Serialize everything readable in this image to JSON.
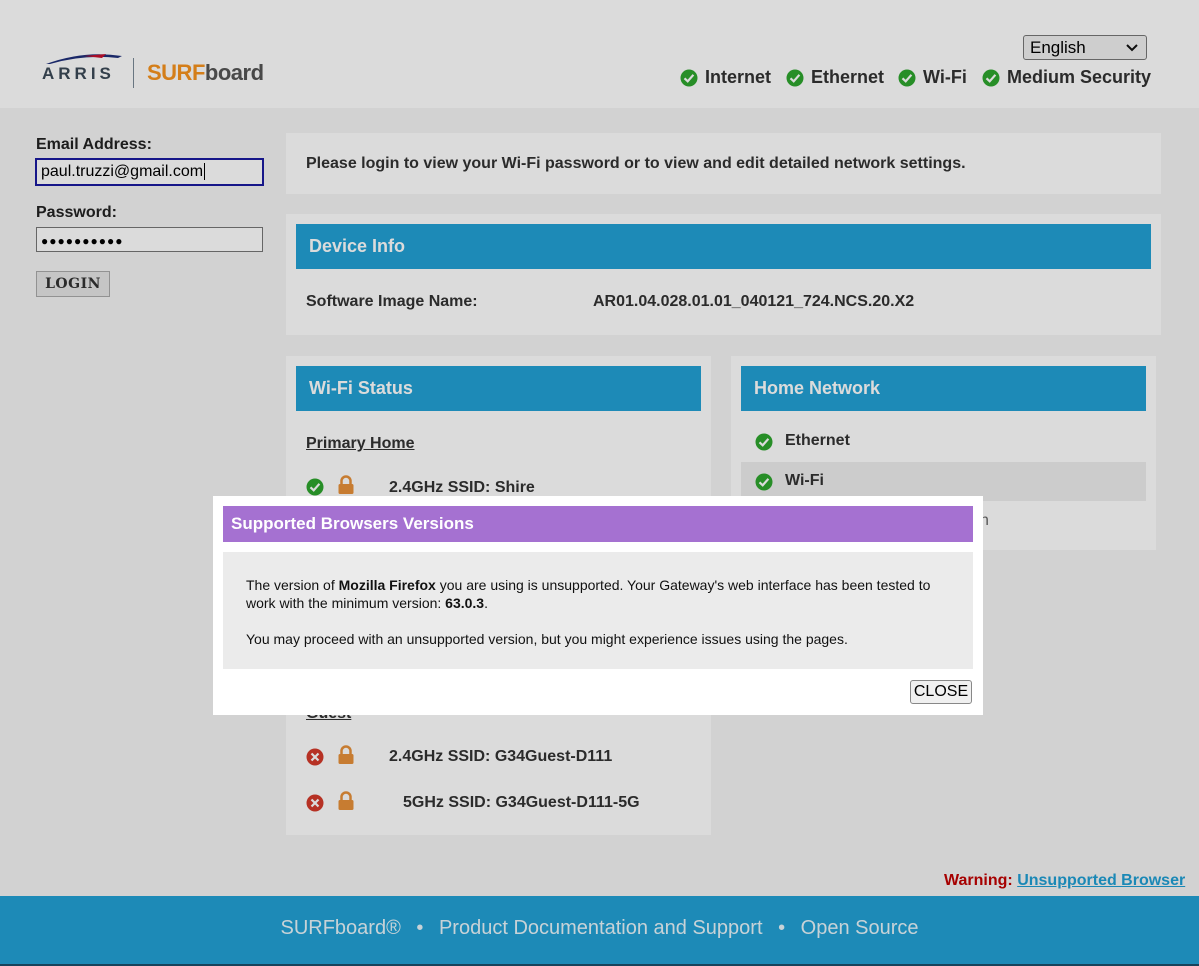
{
  "header": {
    "brand_arris": "ARRIS",
    "brand_surf": "SURF",
    "brand_board": "board",
    "language": "English",
    "statuses": [
      {
        "label": "Internet"
      },
      {
        "label": "Ethernet"
      },
      {
        "label": "Wi-Fi"
      },
      {
        "label": "Medium Security"
      }
    ]
  },
  "login": {
    "email_label": "Email Address:",
    "email_value": "paul.truzzi@gmail.com",
    "password_label": "Password:",
    "password_mask": "●●●●●●●●●●",
    "login_button": "LOGIN"
  },
  "notice": "Please login to view your Wi-Fi password or to view and edit detailed network settings.",
  "device_info": {
    "title": "Device Info",
    "software_label": "Software Image Name:",
    "software_value": "AR01.04.028.01.01_040121_724.NCS.20.X2"
  },
  "wifi_status": {
    "title": "Wi-Fi Status",
    "primary_label": "Primary Home",
    "primary_24_label": "2.4GHz SSID:",
    "primary_24_value": "Shire",
    "guest_label": "Guest",
    "guest_24_label": "2.4GHz SSID:",
    "guest_24_value": "G34Guest-D111",
    "guest_5_label": "5GHz SSID:",
    "guest_5_value": "G34Guest-D111-5G"
  },
  "home_network": {
    "title": "Home Network",
    "items": [
      "Ethernet",
      "Wi-Fi"
    ],
    "partial_text": "n"
  },
  "warning": {
    "label": "Warning:",
    "link": "Unsupported Browser"
  },
  "footer": {
    "links": [
      "SURFboard®",
      "Product Documentation and Support",
      "Open Source"
    ],
    "separator": "•"
  },
  "modal": {
    "title": "Supported Browsers Versions",
    "p1_a": "The version of ",
    "p1_browser": "Mozilla Firefox",
    "p1_b": " you are using is unsupported. Your Gateway's web interface has been tested to work with the minimum version: ",
    "p1_version": "63.0.3",
    "p1_c": ".",
    "p2": "You may proceed with an unsupported version, but you might experience issues using the pages.",
    "close_button": "CLOSE"
  },
  "colors": {
    "accent": "#22a1d5",
    "modal_header": "#a571d1",
    "ok_green": "#2ea62e",
    "error_red": "#d43a2a",
    "lock_orange": "#e8913a",
    "warning_red": "#c20000",
    "brand_orange": "#f7931e"
  }
}
